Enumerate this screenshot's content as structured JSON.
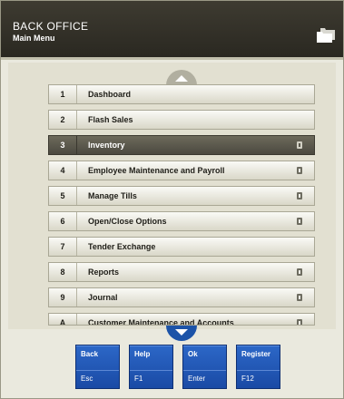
{
  "header": {
    "title": "BACK OFFICE",
    "subtitle": "Main Menu",
    "icon": "folders-icon"
  },
  "menu": {
    "selected_index": 2,
    "items": [
      {
        "num": "1",
        "label": "Dashboard",
        "has_doc": false
      },
      {
        "num": "2",
        "label": "Flash Sales",
        "has_doc": false
      },
      {
        "num": "3",
        "label": "Inventory",
        "has_doc": true
      },
      {
        "num": "4",
        "label": "Employee Maintenance and Payroll",
        "has_doc": true
      },
      {
        "num": "5",
        "label": "Manage Tills",
        "has_doc": true
      },
      {
        "num": "6",
        "label": "Open/Close Options",
        "has_doc": true
      },
      {
        "num": "7",
        "label": "Tender Exchange",
        "has_doc": false
      },
      {
        "num": "8",
        "label": "Reports",
        "has_doc": true
      },
      {
        "num": "9",
        "label": "Journal",
        "has_doc": true
      },
      {
        "num": "A",
        "label": "Customer Maintenance and Accounts",
        "has_doc": true
      }
    ]
  },
  "function_keys": [
    {
      "label": "Back",
      "key": "Esc"
    },
    {
      "label": "Help",
      "key": "F1"
    },
    {
      "label": "Ok",
      "key": "Enter"
    },
    {
      "label": "Register",
      "key": "F12"
    }
  ],
  "colors": {
    "header_bg": "#2e2c25",
    "selected_row": "#5a5749",
    "function_key": "#1f54b3"
  }
}
